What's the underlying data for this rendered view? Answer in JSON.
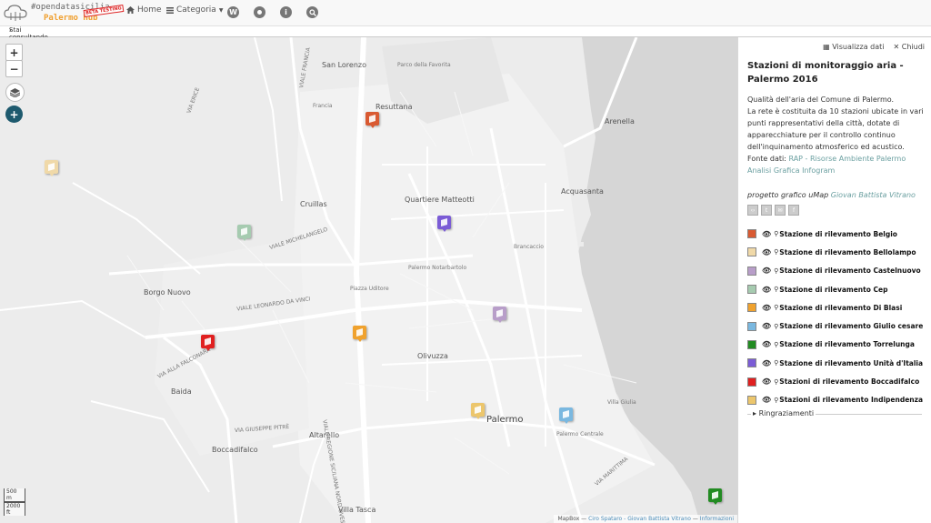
{
  "navbar": {
    "brand_line1": "#opendatasicilia",
    "brand_line2": "Palermo Hub",
    "beta_label": "BETA TESTING",
    "home_label": "Home",
    "category_label": "Categoria",
    "wiki_glyph": "W",
    "info_glyph": "i",
    "icons": [
      "home-icon",
      "list-icon",
      "wikipedia-icon",
      "github-icon",
      "info-icon",
      "search-icon"
    ]
  },
  "breadcrumb": {
    "label": "Stai consultando"
  },
  "map": {
    "zoom_in": "+",
    "zoom_out": "−",
    "add": "+",
    "scale_m": "500 m",
    "scale_ft": "2000 ft",
    "places": [
      {
        "key": "san-lorenzo",
        "label": "San Lorenzo",
        "style": "normal"
      },
      {
        "key": "resuttana",
        "label": "Resuttana",
        "style": "normal"
      },
      {
        "key": "arenella",
        "label": "Arenella",
        "style": "normal"
      },
      {
        "key": "acquasanta",
        "label": "Acquasanta",
        "style": "normal"
      },
      {
        "key": "cruillas",
        "label": "Cruillas",
        "style": "normal"
      },
      {
        "key": "matteotti",
        "label": "Quartiere Matteotti",
        "style": "normal"
      },
      {
        "key": "borgo-nuovo",
        "label": "Borgo Nuovo",
        "style": "normal"
      },
      {
        "key": "olivuzza",
        "label": "Olivuzza",
        "style": "normal"
      },
      {
        "key": "palermo",
        "label": "Palermo",
        "style": "big"
      },
      {
        "key": "baida",
        "label": "Baida",
        "style": "normal"
      },
      {
        "key": "boccadifalco",
        "label": "Boccadifalco",
        "style": "normal"
      },
      {
        "key": "altarello",
        "label": "Altarello",
        "style": "normal"
      },
      {
        "key": "villa-tasca",
        "label": "Villa Tasca",
        "style": "normal"
      },
      {
        "key": "parco-favorita",
        "label": "Parco della Favorita",
        "style": "small"
      },
      {
        "key": "villa-giulia",
        "label": "Villa Giulia",
        "style": "small"
      },
      {
        "key": "palermo-centrale",
        "label": "Palermo Centrale",
        "style": "small"
      },
      {
        "key": "notarbartolo",
        "label": "Palermo Notarbartolo",
        "style": "small"
      },
      {
        "key": "piazza-ucciardone",
        "label": "Piazza Uditore",
        "style": "small"
      },
      {
        "key": "brancaccio",
        "label": "Brancaccio",
        "style": "small"
      },
      {
        "key": "via-michelangelo",
        "label": "VIALE MICHELANGELO",
        "style": "small"
      },
      {
        "key": "via-leonardo",
        "label": "VIALE LEONARDO DA VINCI",
        "style": "small"
      },
      {
        "key": "via-falconara",
        "label": "VIA ALLA FALCONARA",
        "style": "small"
      },
      {
        "key": "via-regione",
        "label": "VIALE REGIONE SICILIANA NORD OVEST",
        "style": "small"
      },
      {
        "key": "via-pitre",
        "label": "VIA GIUSEPPE PITRÈ",
        "style": "small"
      },
      {
        "key": "via-erice",
        "label": "VIA ERICE",
        "style": "small"
      },
      {
        "key": "francia",
        "label": "Francia",
        "style": "small"
      },
      {
        "key": "mondello",
        "label": "VIALE FRANCIA",
        "style": "small"
      },
      {
        "key": "ciro-ferrara",
        "label": "VIA MARITTIMA",
        "style": "small"
      }
    ],
    "markers": [
      {
        "name": "Stazione di rilevamento Belgio",
        "color": "#d95a32"
      },
      {
        "name": "Stazione di rilevamento Bellolampo",
        "color": "#f0d9a8"
      },
      {
        "name": "Stazione di rilevamento Castelnuovo",
        "color": "#b89ec9"
      },
      {
        "name": "Stazione di rilevamento Cep",
        "color": "#a6cbb0"
      },
      {
        "name": "Stazione di rilevamento Di Blasi",
        "color": "#f0a22e"
      },
      {
        "name": "Stazione di rilevamento Giulio cesare",
        "color": "#7ab8e0"
      },
      {
        "name": "Stazione di rilevamento Torrelunga",
        "color": "#228b22"
      },
      {
        "name": "Stazione di rilevamento Unità d'Italia",
        "color": "#7b5cd6"
      },
      {
        "name": "Stazioni di rilevamento Boccadifalco",
        "color": "#e02020"
      },
      {
        "name": "Stazioni di rilevamento Indipendenza",
        "color": "#ecc66c"
      }
    ],
    "attribution": {
      "prefix": "MapBox —",
      "credit": "Ciro Spataro - Giovan Battista Vitrano",
      "sep": "—",
      "info": "Informazioni"
    }
  },
  "panel": {
    "view_data": "Visualizza dati",
    "close": "Chiudi",
    "title": "Stazioni di monitoraggio aria - Palermo 2016",
    "desc_line1": "Qualità dell'aria del Comune di Palermo.",
    "desc_line2": "La rete è costituita da 10 stazioni ubicate in vari punti rappresentativi della città, dotate di apparecchiature per il controllo continuo dell'inquinamento atmosferico ed acustico.",
    "source_label": "Fonte dati:",
    "source_link": "RAP - Risorse Ambiente Palermo",
    "analysis_link": "Analisi Grafica Infogram",
    "credit_prefix": "progetto grafico uMap",
    "credit_link": "Giovan Battista Vitrano",
    "share_icons": [
      "embed-icon",
      "twitter-icon",
      "email-icon",
      "facebook-icon"
    ],
    "thanks": "Ringraziamenti",
    "layers": [
      {
        "name": "Stazione di rilevamento Belgio",
        "color": "#d95a32"
      },
      {
        "name": "Stazione di rilevamento Bellolampo",
        "color": "#f0d9a8"
      },
      {
        "name": "Stazione di rilevamento Castelnuovo",
        "color": "#b89ec9"
      },
      {
        "name": "Stazione di rilevamento Cep",
        "color": "#a6cbb0"
      },
      {
        "name": "Stazione di rilevamento Di Blasi",
        "color": "#f0a22e"
      },
      {
        "name": "Stazione di rilevamento Giulio cesare",
        "color": "#7ab8e0"
      },
      {
        "name": "Stazione di rilevamento Torrelunga",
        "color": "#228b22"
      },
      {
        "name": "Stazione di rilevamento Unità d'Italia",
        "color": "#7b5cd6"
      },
      {
        "name": "Stazioni di rilevamento Boccadifalco",
        "color": "#e02020"
      },
      {
        "name": "Stazioni di rilevamento Indipendenza",
        "color": "#ecc66c"
      }
    ]
  }
}
